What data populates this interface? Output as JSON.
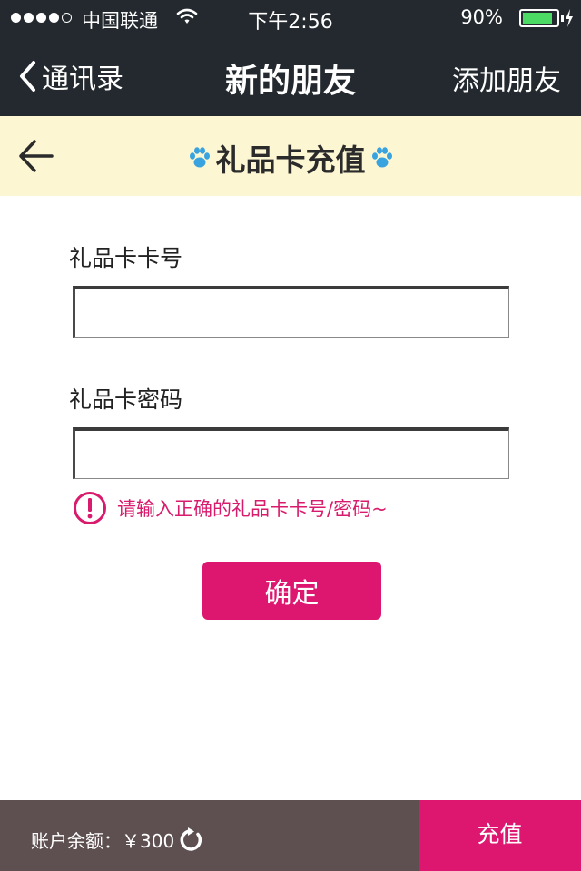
{
  "status_bar": {
    "carrier": "中国联通",
    "time": "下午2:56",
    "battery_percent": "90%",
    "battery_level": 0.9,
    "signal_bars": 4,
    "icons": [
      "signal-dots-icon",
      "wifi-icon",
      "battery-icon",
      "charging-bolt-icon"
    ]
  },
  "nav": {
    "back_label": "通讯录",
    "title": "新的朋友",
    "right_label": "添加朋友",
    "background": "#23292e"
  },
  "sub_header": {
    "title": "礼品卡充值",
    "background": "#fdf6d3",
    "icons": [
      "arrow-left-icon",
      "paw-icon"
    ]
  },
  "form": {
    "card_number_label": "礼品卡卡号",
    "card_number_value": "",
    "password_label": "礼品卡密码",
    "password_value": "",
    "error_message": "请输入正确的礼品卡卡号/密码~",
    "confirm_label": "确定"
  },
  "footer": {
    "balance_text": "账户余额：￥300",
    "recharge_label": "充值",
    "background": "#5e5050"
  },
  "colors": {
    "accent": "#dd1670",
    "paw": "#39a3e0"
  }
}
